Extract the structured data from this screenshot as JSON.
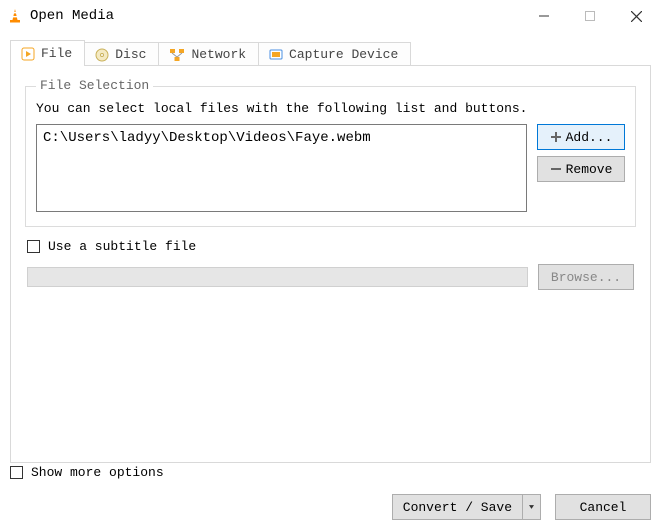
{
  "window": {
    "title": "Open Media"
  },
  "tabs": {
    "file": "File",
    "disc": "Disc",
    "network": "Network",
    "capture": "Capture Device"
  },
  "fileSelection": {
    "legend": "File Selection",
    "help": "You can select local files with the following list and buttons.",
    "files": [
      "C:\\Users\\ladyy\\Desktop\\Videos\\Faye.webm"
    ],
    "addLabel": "Add...",
    "removeLabel": "Remove"
  },
  "subtitle": {
    "label": "Use a subtitle file",
    "path": "",
    "browse": "Browse..."
  },
  "footer": {
    "showMore": "Show more options",
    "convert": "Convert / Save",
    "cancel": "Cancel"
  }
}
